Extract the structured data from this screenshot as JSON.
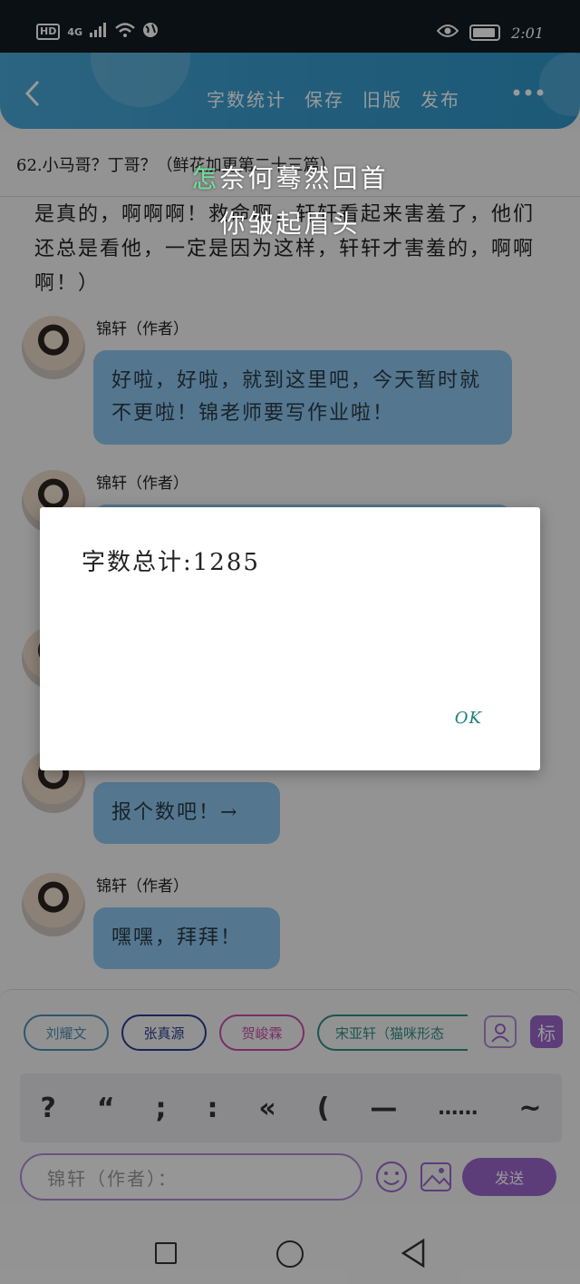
{
  "status": {
    "hd": "HD",
    "network": "4G",
    "time": "2:01"
  },
  "header": {
    "nav": [
      "字数统计",
      "保存",
      "旧版",
      "发布"
    ],
    "back_icon": "back-chevron-icon",
    "more_icon": "more-dots-icon"
  },
  "chapter_title": "62.小马哥？丁哥？（鲜花加更第二十三篇）",
  "paragraph": "是真的，啊啊啊！救命啊，轩轩看起来害羞了，他们还总是看他，一定是因为这样，轩轩才害羞的，啊啊啊！）",
  "messages": [
    {
      "author": "锦轩（作者）",
      "text": "好啦，好啦，就到这里吧，今天暂时就不更啦！锦老师要写作业啦！"
    },
    {
      "author": "锦轩（作者）",
      "text": ""
    },
    {
      "author": "",
      "text": ""
    },
    {
      "author": "",
      "text": "报个数吧！→"
    },
    {
      "author": "锦轩（作者）",
      "text": "嘿嘿，拜拜！"
    }
  ],
  "characters": [
    "刘耀文",
    "张真源",
    "贺峻霖",
    "宋亚轩（猫咪形态"
  ],
  "character_colors": [
    "#4f8fb0",
    "#2a3f8a",
    "#c94fa8",
    "#2f8f7f"
  ],
  "tag_button": "标",
  "punctuation": [
    "?",
    "“",
    ";",
    ":",
    "«",
    "(",
    "—",
    "……",
    "~"
  ],
  "input_placeholder": "锦轩（作者）：",
  "send_label": "发送",
  "lyrics": {
    "line1_highlight": "怎",
    "line1_rest": "奈何蓦然回首",
    "line2": "你皱起眉头"
  },
  "dialog": {
    "message": "字数总计:1285",
    "ok": "OK"
  }
}
